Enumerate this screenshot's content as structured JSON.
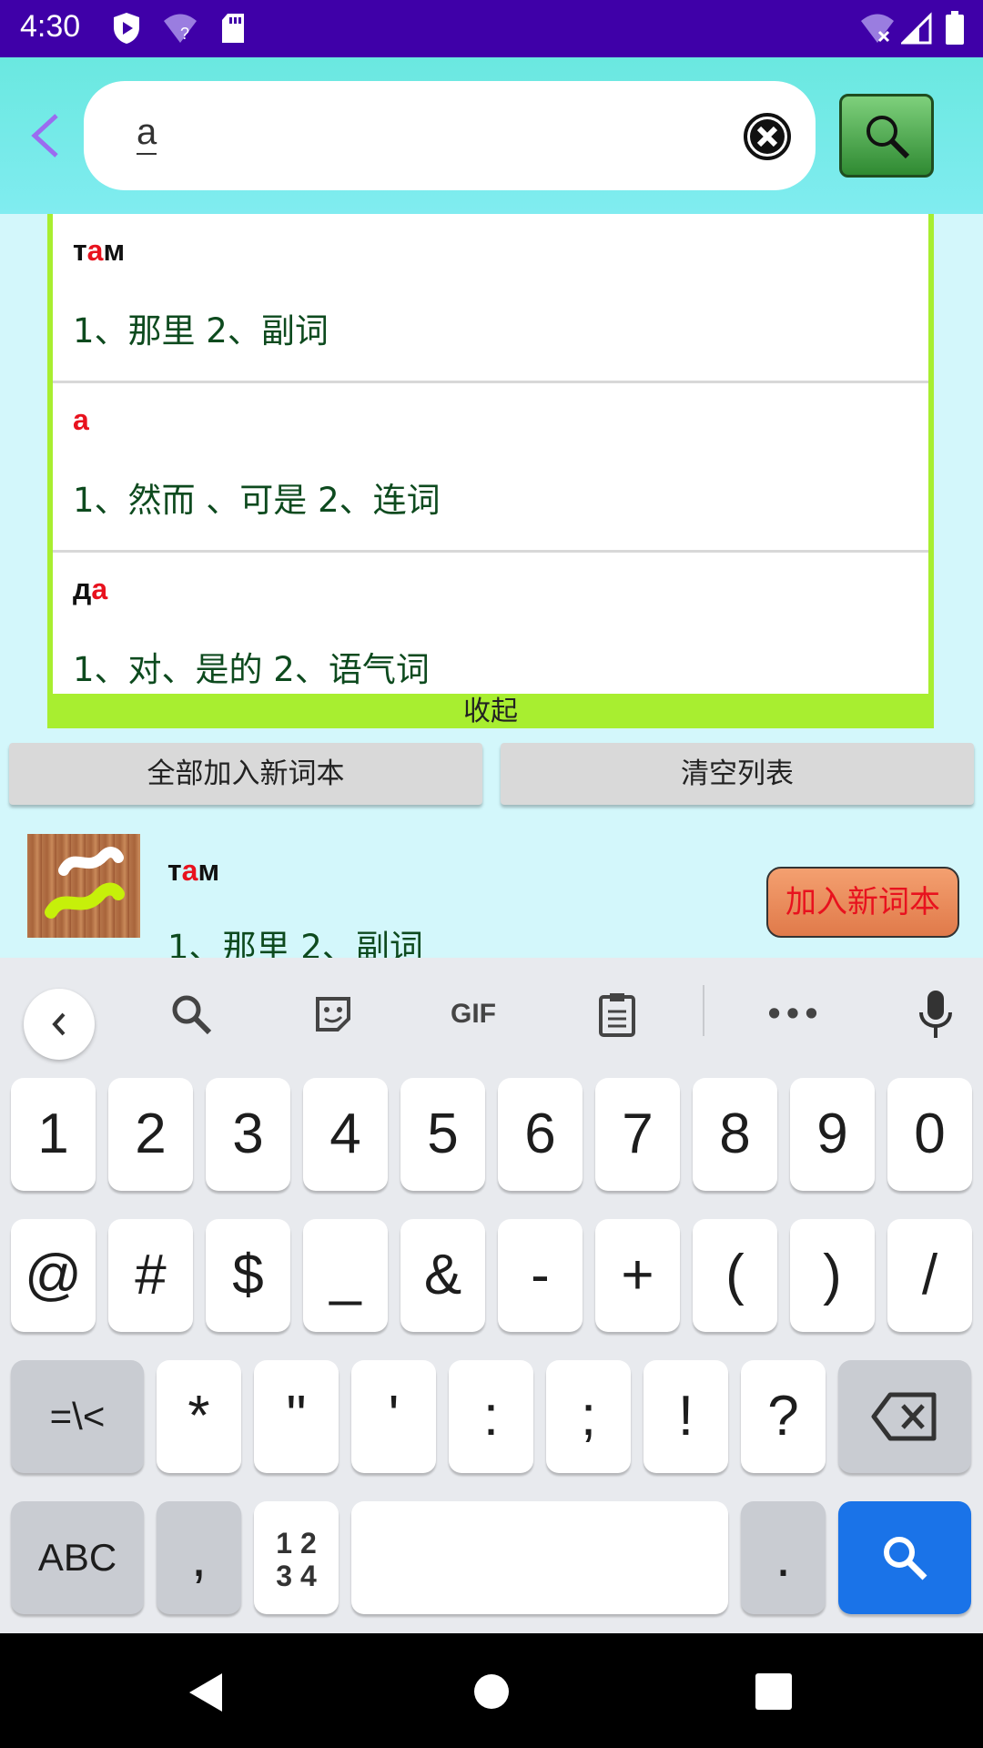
{
  "status_bar": {
    "time": "4:30"
  },
  "search": {
    "query": "a"
  },
  "suggestions": [
    {
      "word_before": "т",
      "word_match": "а",
      "word_after": "м",
      "definition": "1、那里 2、副词"
    },
    {
      "word_before": "",
      "word_match": "а",
      "word_after": "",
      "definition": "1、然而 、可是  2、连词"
    },
    {
      "word_before": "д",
      "word_match": "а",
      "word_after": "",
      "definition": "1、对、是的 2、语气词"
    }
  ],
  "collapse_label": "收起",
  "actions": {
    "add_all_label": "全部加入新词本",
    "clear_label": "清空列表"
  },
  "result": {
    "word_before": "т",
    "word_match": "а",
    "word_after": "м",
    "definition": "1、那里 2、副词",
    "add_label": "加入新词本"
  },
  "keyboard": {
    "toolbar": {
      "gif_label": "GIF",
      "more_label": "•••"
    },
    "row1": [
      "1",
      "2",
      "3",
      "4",
      "5",
      "6",
      "7",
      "8",
      "9",
      "0"
    ],
    "row2": [
      "@",
      "#",
      "$",
      "_",
      "&",
      "-",
      "+",
      "(",
      ")",
      "/"
    ],
    "row3": [
      "*",
      "\"",
      "'",
      ":",
      ";",
      "!",
      "?"
    ],
    "symbols_toggle": "=\\<",
    "abc_label": "ABC",
    "comma": ",",
    "numpad_label_top": "1 2",
    "numpad_label_bottom": "3 4",
    "period": "."
  },
  "colors": {
    "status_bar": "#3f00a8",
    "header": "#6ae8e0",
    "highlight": "#e8121e",
    "definition": "#0d4a1e",
    "dropdown_border": "#a8ee30",
    "search_key": "#1a73e8"
  }
}
